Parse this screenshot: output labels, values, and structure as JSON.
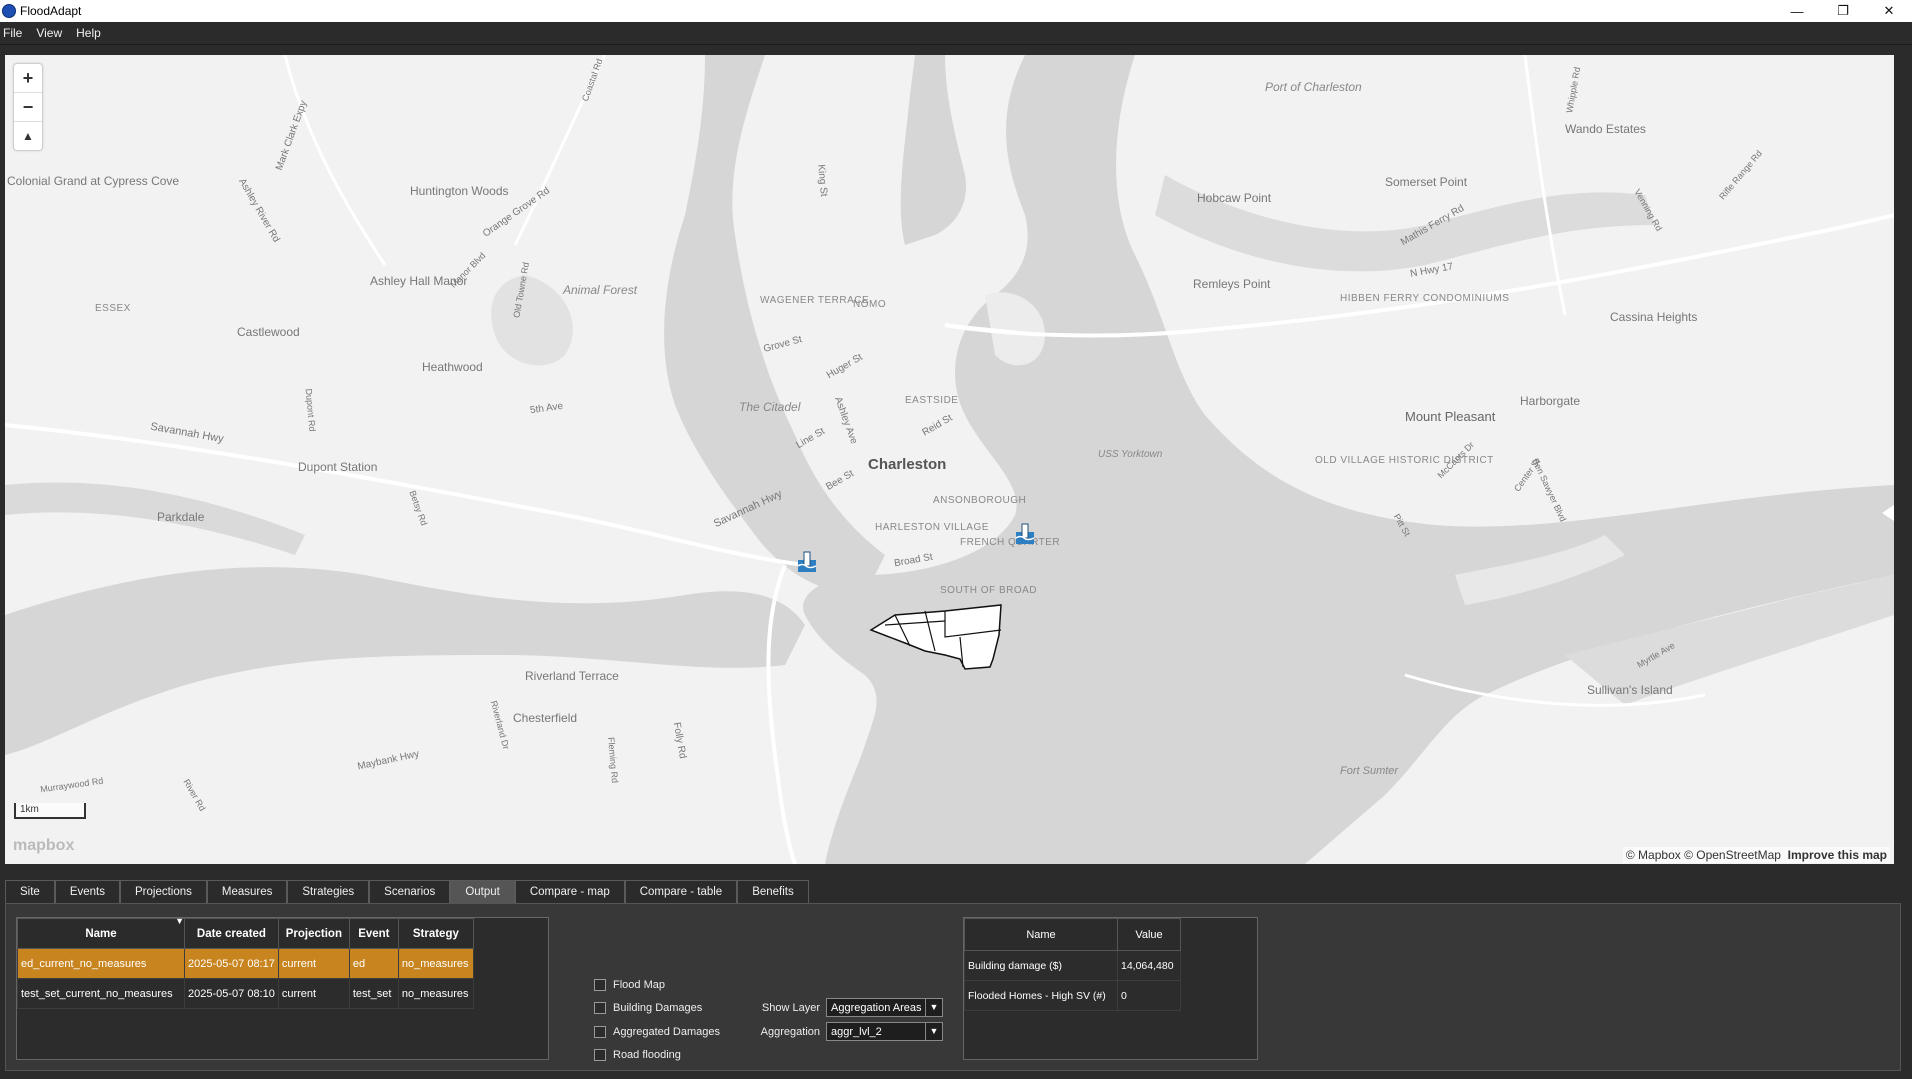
{
  "window": {
    "title": "FloodAdapt",
    "minimize": "—",
    "maximize": "❐",
    "close": "✕"
  },
  "menu": [
    "File",
    "View",
    "Help"
  ],
  "map": {
    "zoom_in": "+",
    "zoom_out": "−",
    "compass": "▲",
    "scale": "1km",
    "logo": "mapbox",
    "attribution": "© Mapbox © OpenStreetMap",
    "improve": "Improve this map",
    "labels": {
      "port": "Port of Charleston",
      "colonial": "Colonial Grand at Cypress Cove",
      "huntington": "Huntington Woods",
      "ashleyhall": "Ashley Hall Manor",
      "essex": "ESSEX",
      "castlewood": "Castlewood",
      "heathwood": "Heathwood",
      "dupontstation": "Dupont Station",
      "parkdale": "Parkdale",
      "animalforest": "Animal Forest",
      "wagener": "WAGENER TERRACE",
      "nomo": "NOMO",
      "citadel": "The Citadel",
      "eastside": "EASTSIDE",
      "charleston": "Charleston",
      "ansonborough": "ANSONBOROUGH",
      "harleston": "HARLESTON VILLAGE",
      "french": "FRENCH QUARTER",
      "southofbroad": "SOUTH OF BROAD",
      "ussyorktown": "USS Yorktown",
      "hobcaw": "Hobcaw Point",
      "somerset": "Somerset Point",
      "wando": "Wando Estates",
      "remleys": "Remleys Point",
      "hibben": "HIBBEN FERRY CONDOMINIUMS",
      "cassina": "Cassina Heights",
      "harborgate": "Harborgate",
      "mountpleasant": "Mount Pleasant",
      "oldvillage": "OLD VILLAGE HISTORIC DISTRICT",
      "sullivans": "Sullivan's Island",
      "fortsumter": "Fort Sumter",
      "riverland": "Riverland Terrace",
      "chesterfield": "Chesterfield",
      "savannahhwy": "Savannah Hwy",
      "savannahhwy2": "Savannah Hwy",
      "maybank": "Maybank Hwy",
      "folly": "Folly Rd",
      "huger": "Huger St",
      "king": "King St",
      "nhwy17": "N Hwy 17",
      "mathis": "Mathis Ferry Rd",
      "orangegrove": "Orange Grove Rd",
      "ashleyriver": "Ashley River Rd",
      "marsclark": "Mark Clark Expy",
      "grove": "Grove St",
      "fifth": "5th Ave",
      "bee": "Bee St",
      "line": "Line St",
      "ashleyave": "Ashley Ave",
      "reid": "Reid St",
      "broad": "Broad St",
      "myrtle": "Myrtle Ave",
      "riverlanddr": "Riverland Dr",
      "fleming": "Fleming Rd",
      "murraywood": "Murraywood Rd",
      "riverrd": "River Rd",
      "pitt": "Pitt St",
      "centerst": "Center St",
      "mccants": "McCants Dr",
      "bensawyer": "Ben Sawyer Blvd",
      "dupontrd": "Dupont Rd",
      "betsy": "Betsy Rd",
      "oldtowne": "Old Towne Rd",
      "manor": "Manor Blvd",
      "rifle": "Rifle Range Rd",
      "venning": "Venning Rd",
      "whipple": "Whipple Rd",
      "coastal": "Coastal Rd"
    }
  },
  "tabs": [
    "Site",
    "Events",
    "Projections",
    "Measures",
    "Strategies",
    "Scenarios",
    "Output",
    "Compare - map",
    "Compare - table",
    "Benefits"
  ],
  "active_tab": "Output",
  "scenarios": {
    "headers": [
      "Name",
      "Date created",
      "Projection",
      "Event",
      "Strategy"
    ],
    "sort_indicator": "▼",
    "rows": [
      [
        "ed_current_no_measures",
        "2025-05-07 08:17",
        "current",
        "ed",
        "no_measures"
      ],
      [
        "test_set_current_no_measures",
        "2025-05-07 08:10",
        "current",
        "test_set",
        "no_measures"
      ]
    ]
  },
  "layers": {
    "checkboxes": [
      "Flood Map",
      "Building Damages",
      "Aggregated Damages",
      "Road flooding"
    ],
    "show_layer_label": "Show Layer",
    "show_layer_value": "Aggregation Areas",
    "aggregation_label": "Aggregation",
    "aggregation_value": "aggr_lvl_2",
    "dropdown_arrow": "▼"
  },
  "results": {
    "headers": [
      "Name",
      "Value"
    ],
    "rows": [
      [
        "Building damage ($)",
        "14,064,480"
      ],
      [
        "Flooded Homes - High SV (#)",
        "0"
      ]
    ]
  },
  "colors": {
    "selected_row": "#c8851f",
    "water": "#d6d6d6",
    "land": "#f2f2f2"
  }
}
